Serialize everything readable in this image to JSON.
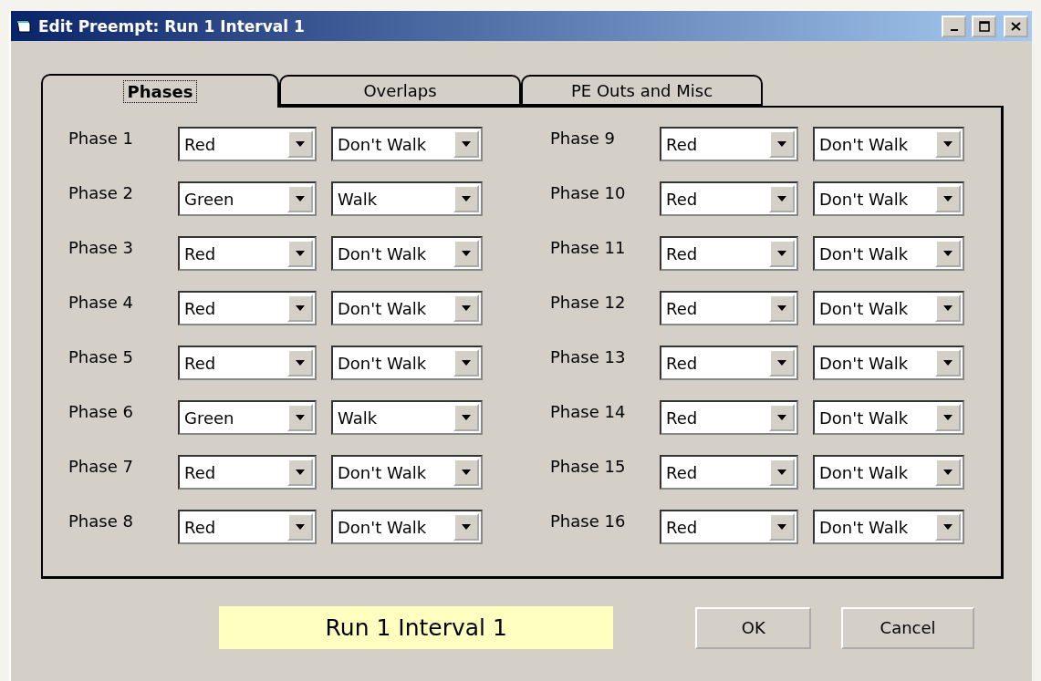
{
  "window": {
    "title": "Edit Preempt: Run 1 Interval 1"
  },
  "tabs": [
    {
      "label": "Phases",
      "selected": true
    },
    {
      "label": "Overlaps",
      "selected": false
    },
    {
      "label": "PE Outs and Misc",
      "selected": false
    }
  ],
  "phases": [
    {
      "label": "Phase 1",
      "signal": "Red",
      "pedestrian": "Don't Walk"
    },
    {
      "label": "Phase 2",
      "signal": "Green",
      "pedestrian": "Walk"
    },
    {
      "label": "Phase 3",
      "signal": "Red",
      "pedestrian": "Don't Walk"
    },
    {
      "label": "Phase 4",
      "signal": "Red",
      "pedestrian": "Don't Walk"
    },
    {
      "label": "Phase 5",
      "signal": "Red",
      "pedestrian": "Don't Walk"
    },
    {
      "label": "Phase 6",
      "signal": "Green",
      "pedestrian": "Walk"
    },
    {
      "label": "Phase 7",
      "signal": "Red",
      "pedestrian": "Don't Walk"
    },
    {
      "label": "Phase 8",
      "signal": "Red",
      "pedestrian": "Don't Walk"
    },
    {
      "label": "Phase 9",
      "signal": "Red",
      "pedestrian": "Don't Walk"
    },
    {
      "label": "Phase 10",
      "signal": "Red",
      "pedestrian": "Don't Walk"
    },
    {
      "label": "Phase 11",
      "signal": "Red",
      "pedestrian": "Don't Walk"
    },
    {
      "label": "Phase 12",
      "signal": "Red",
      "pedestrian": "Don't Walk"
    },
    {
      "label": "Phase 13",
      "signal": "Red",
      "pedestrian": "Don't Walk"
    },
    {
      "label": "Phase 14",
      "signal": "Red",
      "pedestrian": "Don't Walk"
    },
    {
      "label": "Phase 15",
      "signal": "Red",
      "pedestrian": "Don't Walk"
    },
    {
      "label": "Phase 16",
      "signal": "Red",
      "pedestrian": "Don't Walk"
    }
  ],
  "status": "Run 1 Interval 1",
  "buttons": [
    "OK",
    "Cancel"
  ]
}
